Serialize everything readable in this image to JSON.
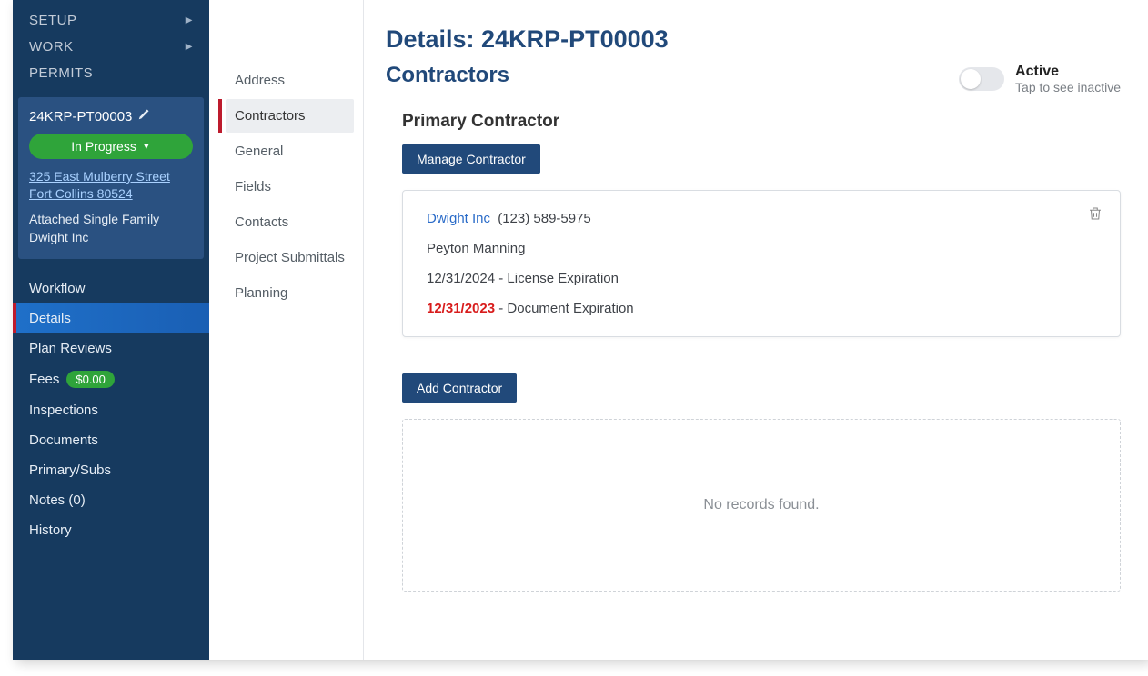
{
  "topnav": {
    "setup": "SETUP",
    "work": "WORK",
    "permits": "PERMITS"
  },
  "permit": {
    "id": "24KRP-PT00003",
    "status": "In Progress",
    "address": "325 East Mulberry Street Fort Collins 80524",
    "type": "Attached Single Family",
    "contractor": "Dwight Inc"
  },
  "secnav": {
    "workflow": "Workflow",
    "details": "Details",
    "plan_reviews": "Plan Reviews",
    "fees": "Fees",
    "fees_badge": "$0.00",
    "inspections": "Inspections",
    "documents": "Documents",
    "primary_subs": "Primary/Subs",
    "notes": "Notes  (0)",
    "history": "History"
  },
  "subnav": {
    "address": "Address",
    "contractors": "Contractors",
    "general": "General",
    "fields": "Fields",
    "contacts": "Contacts",
    "project_submittals": "Project Submittals",
    "planning": "Planning"
  },
  "page": {
    "title_prefix": "Details: ",
    "title_id": "24KRP-PT00003"
  },
  "section": {
    "title": "Contractors",
    "toggle_label": "Active",
    "toggle_hint": "Tap to see inactive"
  },
  "primary": {
    "heading": "Primary Contractor",
    "manage_btn": "Manage Contractor",
    "name_link": "Dwight Inc",
    "phone": "(123) 589-5975",
    "contact": "Peyton Manning",
    "license_date": "12/31/2024",
    "license_label": " - License Expiration",
    "doc_date": "12/31/2023",
    "doc_label": " - Document Expiration"
  },
  "additional": {
    "add_btn": "Add Contractor",
    "empty": "No records found."
  }
}
